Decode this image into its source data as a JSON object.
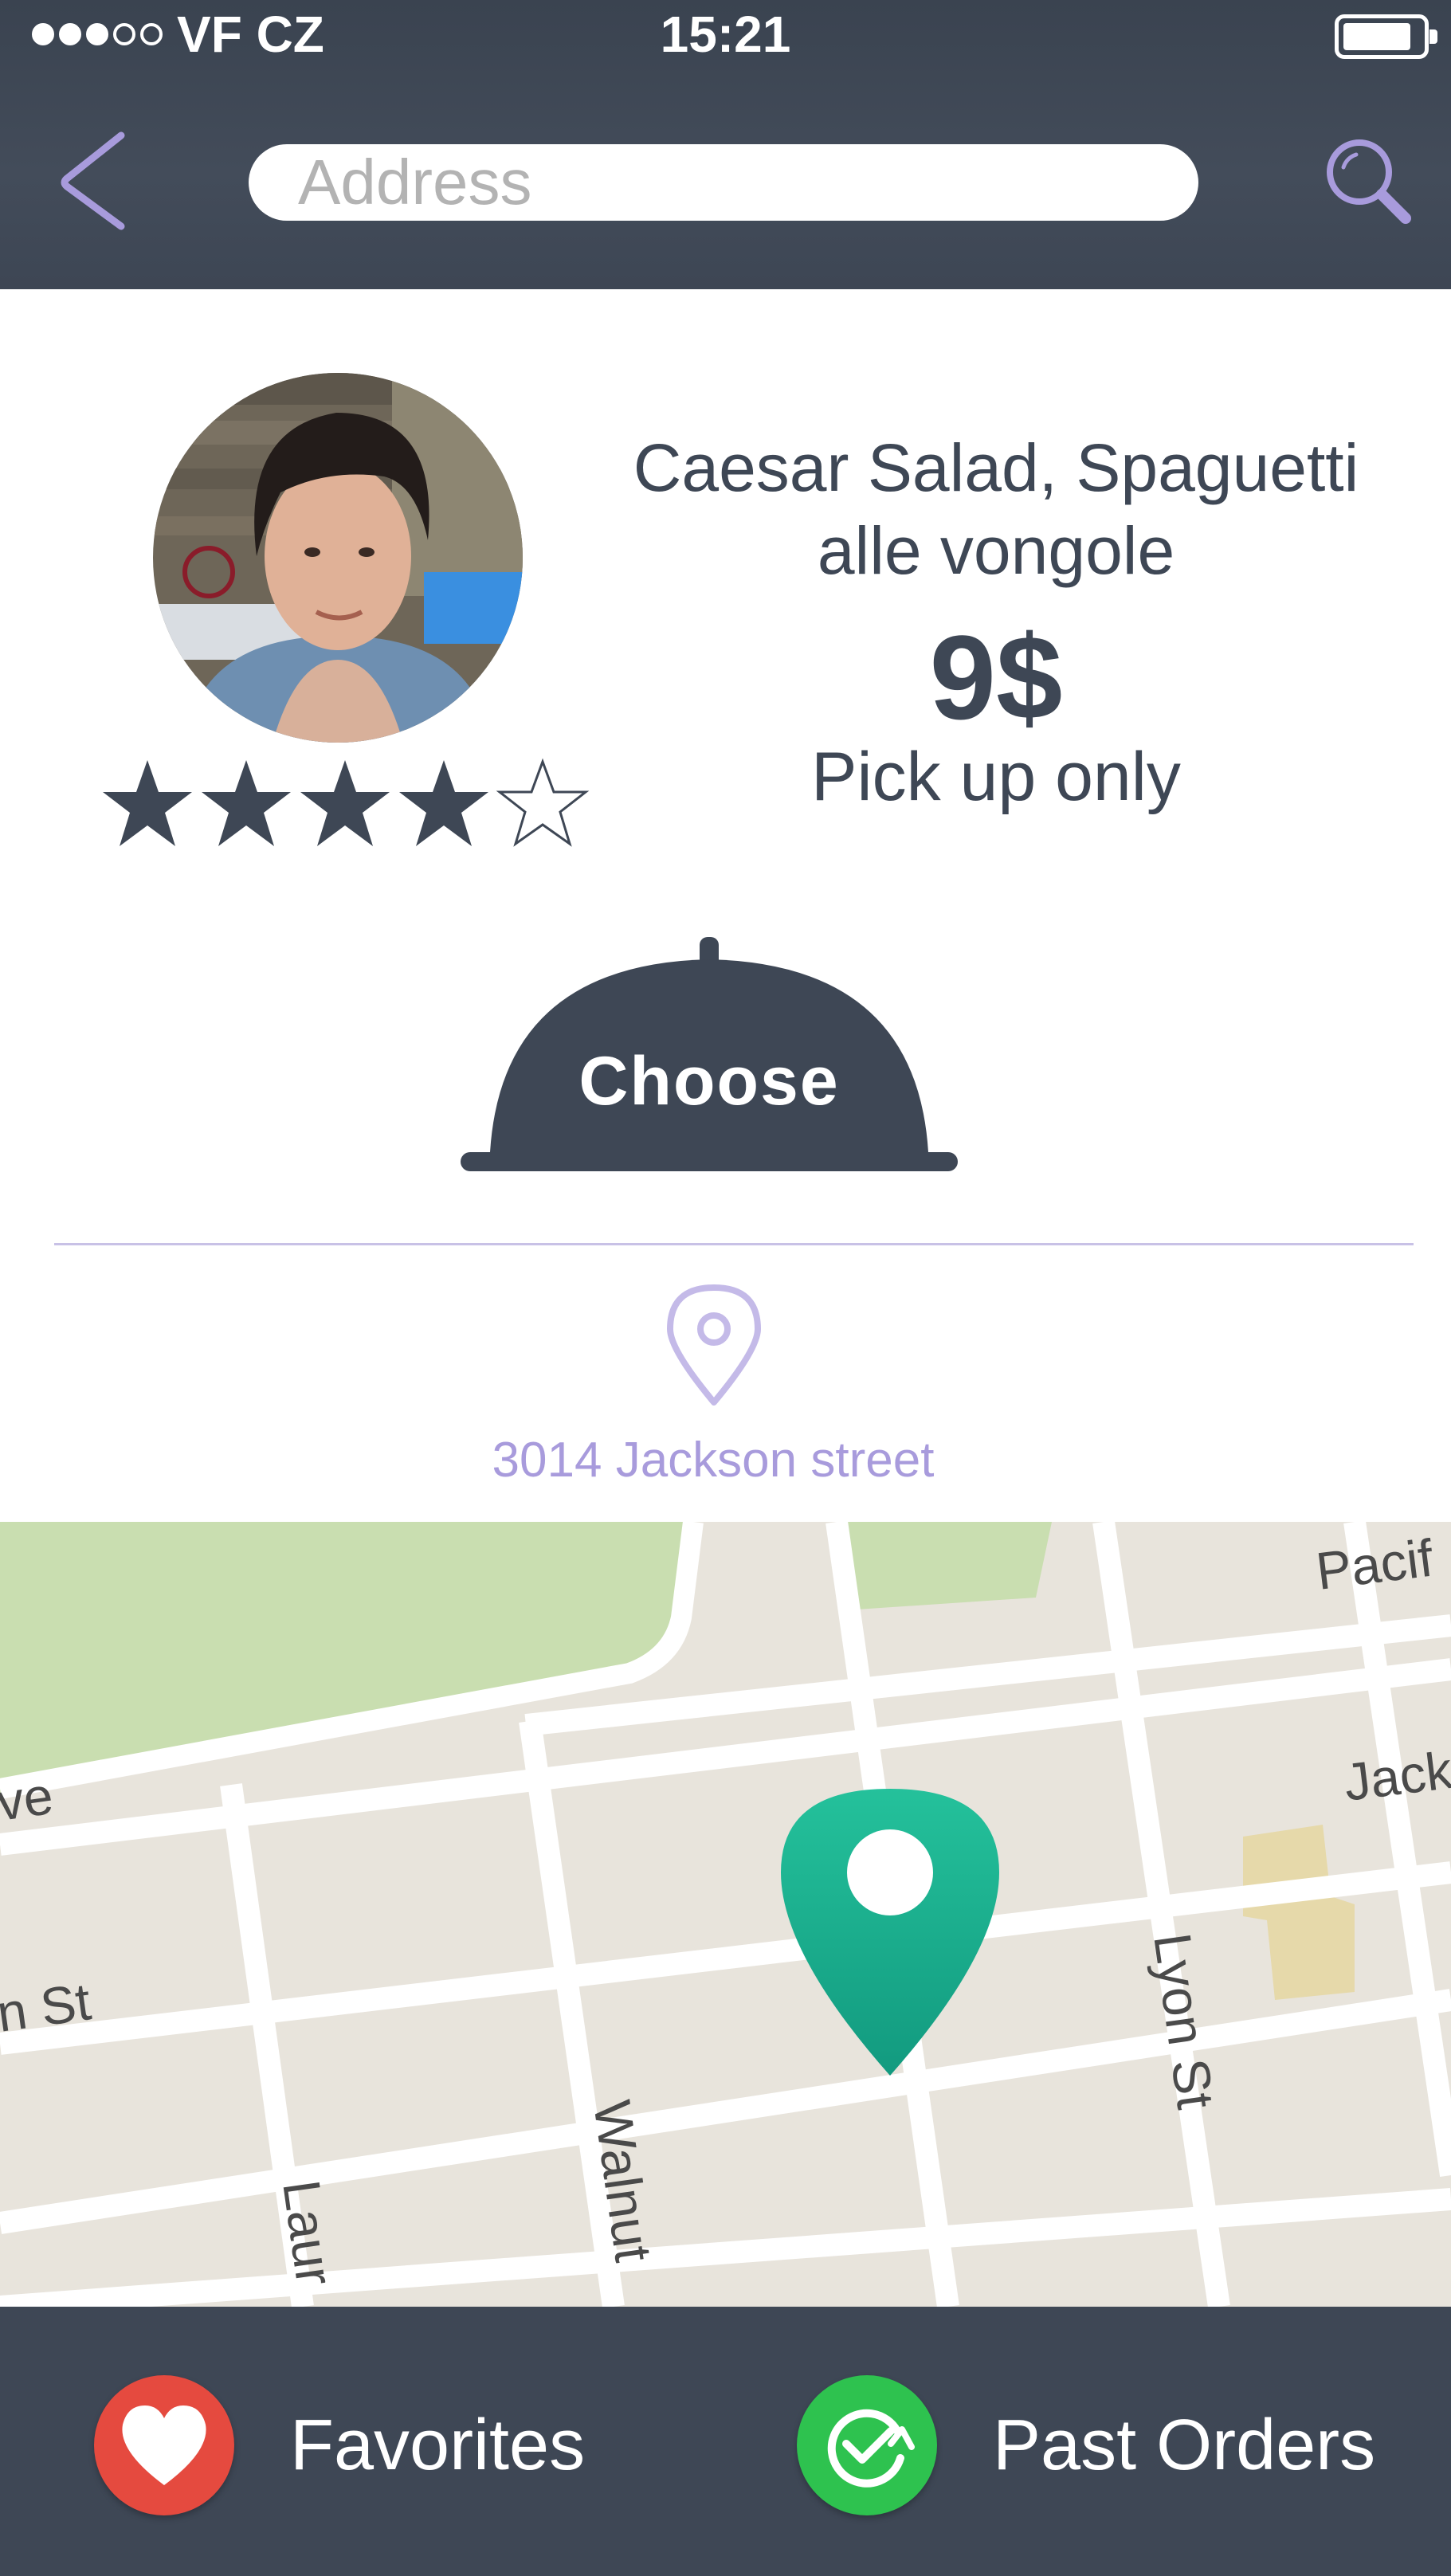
{
  "status_bar": {
    "carrier": "VF CZ",
    "signal_filled": 3,
    "signal_total": 5,
    "time": "15:21",
    "battery_level": 0.85
  },
  "header": {
    "back_icon": "chevron-left-icon",
    "search_placeholder": "Address",
    "search_value": "",
    "search_icon": "magnifier-icon"
  },
  "vendor": {
    "photo": "vendor-portrait",
    "rating": 4,
    "rating_max": 5
  },
  "offer": {
    "dish_line1": "Caesar Salad, Spaguetti",
    "dish_line2": "alle vongole",
    "price": "9$",
    "delivery_note": "Pick up only"
  },
  "choose_button": {
    "label": "Choose",
    "icon": "cloche-icon"
  },
  "location": {
    "icon": "map-pin-outline-icon",
    "address": "3014 Jackson street"
  },
  "map": {
    "street_labels": [
      "Pacif",
      "Jack",
      "ve",
      "n St",
      "Lyon St",
      "Walnut",
      "Laur"
    ],
    "marker_icon": "map-marker-icon"
  },
  "bottom_nav": {
    "favorites_label": "Favorites",
    "favorites_icon": "heart-icon",
    "past_orders_label": "Past Orders",
    "past_orders_icon": "check-refresh-icon"
  },
  "colors": {
    "header_bg": "#3e4755",
    "text_primary": "#3e4755",
    "accent_lavender": "#a89bdc",
    "favorites_red": "#e54a3f",
    "past_orders_green": "#2ec24f",
    "marker_teal": "#1aa88d"
  }
}
